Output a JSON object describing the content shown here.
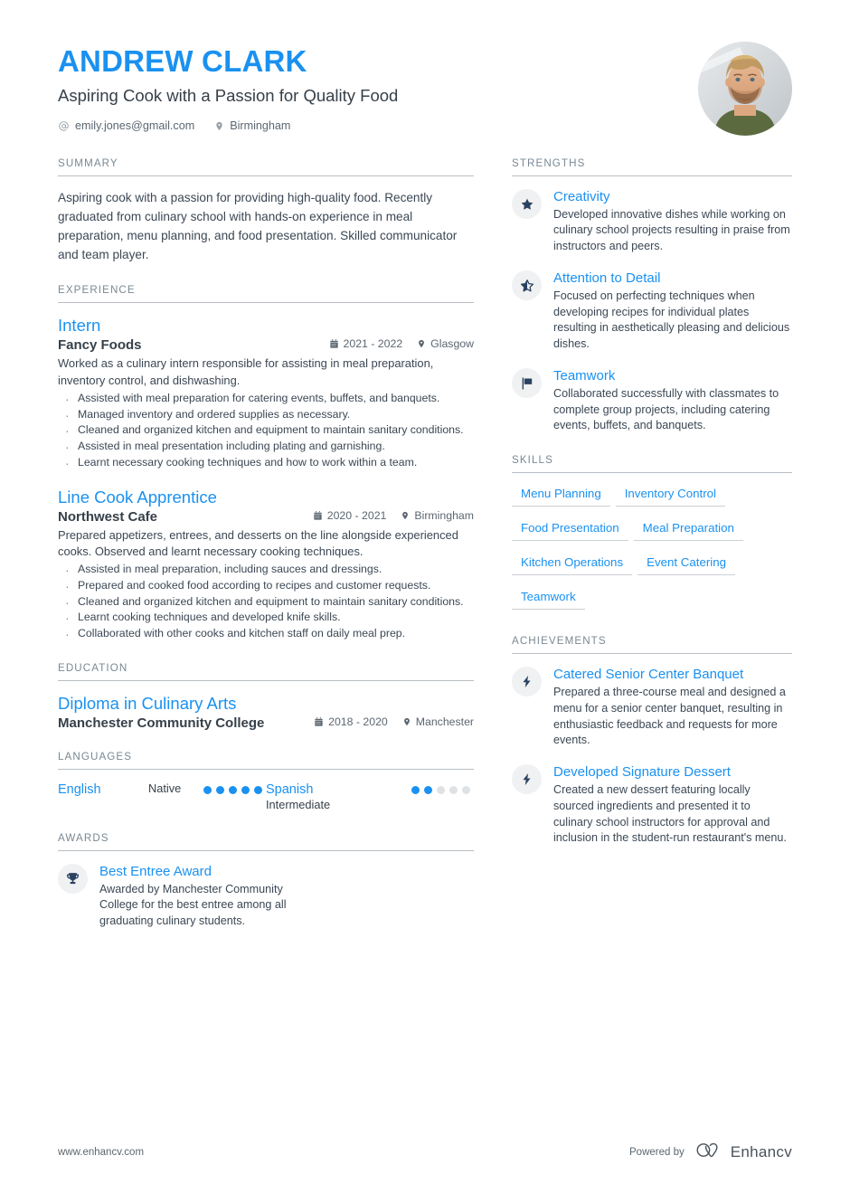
{
  "header": {
    "name": "ANDREW CLARK",
    "headline": "Aspiring Cook with a Passion for Quality Food",
    "email": "emily.jones@gmail.com",
    "location": "Birmingham"
  },
  "summary": {
    "title": "SUMMARY",
    "text": "Aspiring cook with a passion for providing high-quality food. Recently graduated from culinary school with hands-on experience in meal preparation, menu planning, and food presentation. Skilled communicator and team player."
  },
  "experience": {
    "title": "EXPERIENCE",
    "entries": [
      {
        "role": "Intern",
        "company": "Fancy Foods",
        "dates": "2021 - 2022",
        "location": "Glasgow",
        "description": "Worked as a culinary intern responsible for assisting in meal preparation, inventory control, and dishwashing.",
        "bullets": [
          "Assisted with meal preparation for catering events, buffets, and banquets.",
          "Managed inventory and ordered supplies as necessary.",
          "Cleaned and organized kitchen and equipment to maintain sanitary conditions.",
          "Assisted in meal presentation including plating and garnishing.",
          "Learnt necessary cooking techniques and how to work within a team."
        ]
      },
      {
        "role": "Line Cook Apprentice",
        "company": "Northwest Cafe",
        "dates": "2020 - 2021",
        "location": "Birmingham",
        "description": "Prepared appetizers, entrees, and desserts on the line alongside experienced cooks. Observed and learnt necessary cooking techniques.",
        "bullets": [
          "Assisted in meal preparation, including sauces and dressings.",
          "Prepared and cooked food according to recipes and customer requests.",
          "Cleaned and organized kitchen and equipment to maintain sanitary conditions.",
          "Learnt cooking techniques and developed knife skills.",
          "Collaborated with other cooks and kitchen staff on daily meal prep."
        ]
      }
    ]
  },
  "education": {
    "title": "EDUCATION",
    "entries": [
      {
        "degree": "Diploma in Culinary Arts",
        "school": "Manchester Community College",
        "dates": "2018 - 2020",
        "location": "Manchester"
      }
    ]
  },
  "languages": {
    "title": "LANGUAGES",
    "items": [
      {
        "name": "English",
        "level": "Native",
        "filled": 5,
        "total": 5
      },
      {
        "name": "Spanish",
        "level": "Intermediate",
        "filled": 2,
        "total": 5
      }
    ]
  },
  "awards": {
    "title": "AWARDS",
    "items": [
      {
        "icon": "trophy-icon",
        "title": "Best Entree Award",
        "text": "Awarded by Manchester Community College for the best entree among all graduating culinary students."
      }
    ]
  },
  "strengths": {
    "title": "STRENGTHS",
    "items": [
      {
        "icon": "star-filled-icon",
        "title": "Creativity",
        "text": "Developed innovative dishes while working on culinary school projects resulting in praise from instructors and peers."
      },
      {
        "icon": "star-half-icon",
        "title": "Attention to Detail",
        "text": "Focused on perfecting techniques when developing recipes for individual plates resulting in aesthetically pleasing and delicious dishes."
      },
      {
        "icon": "flag-icon",
        "title": "Teamwork",
        "text": "Collaborated successfully with classmates to complete group projects, including catering events, buffets, and banquets."
      }
    ]
  },
  "skills": {
    "title": "SKILLS",
    "items": [
      "Menu Planning",
      "Inventory Control",
      "Food Presentation",
      "Meal Preparation",
      "Kitchen Operations",
      "Event Catering",
      "Teamwork"
    ]
  },
  "achievements": {
    "title": "ACHIEVEMENTS",
    "items": [
      {
        "icon": "lightning-icon",
        "title": "Catered Senior Center Banquet",
        "text": "Prepared a three-course meal and designed a menu for a senior center banquet, resulting in enthusiastic feedback and requests for more events."
      },
      {
        "icon": "lightning-icon",
        "title": "Developed Signature Dessert",
        "text": "Created a new dessert featuring locally sourced ingredients and presented it to culinary school instructors for approval and inclusion in the student-run restaurant's menu."
      }
    ]
  },
  "footer": {
    "url": "www.enhancv.com",
    "powered_by": "Powered by",
    "brand": "Enhancv"
  },
  "colors": {
    "accent": "#1a91f0",
    "heading": "#36404a",
    "muted": "#7a8893",
    "body": "#3b4754",
    "icon_navy": "#2b4260",
    "rule": "#b9bfc5"
  }
}
